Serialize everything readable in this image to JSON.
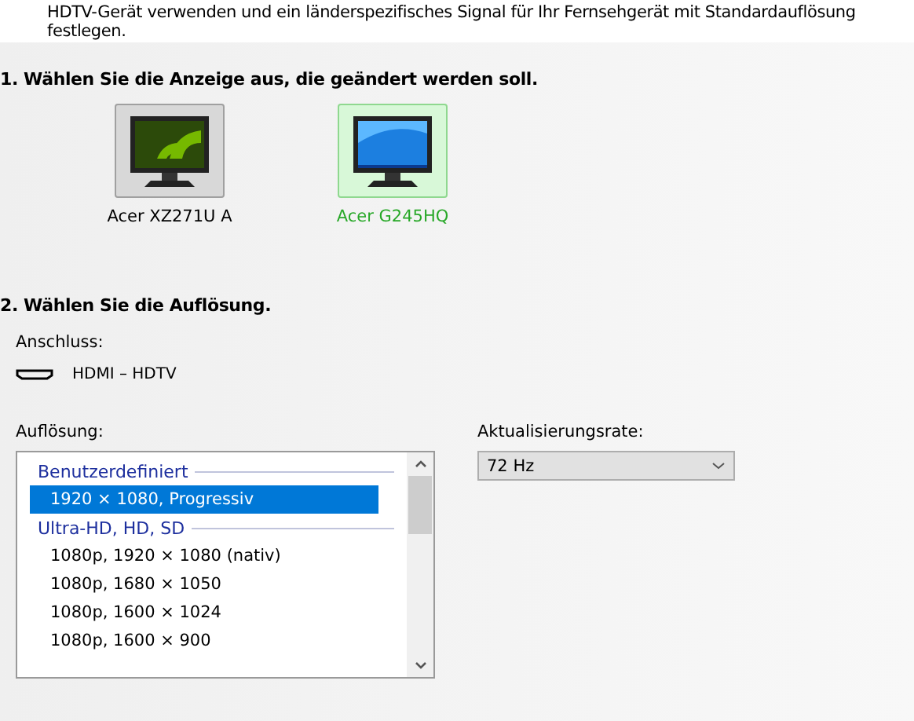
{
  "intro_text": "HDTV-Gerät verwenden und ein länderspezifisches Signal für Ihr Fernsehgerät mit Standardauflösung festlegen.",
  "step1": {
    "heading": "1. Wählen Sie die Anzeige aus, die geändert werden soll.",
    "displays": [
      {
        "name": "Acer XZ271U A",
        "kind": "green",
        "selected": false
      },
      {
        "name": "Acer G245HQ",
        "kind": "blue",
        "selected": true
      }
    ]
  },
  "step2": {
    "heading": "2. Wählen Sie die Auflösung.",
    "connector_label": "Anschluss:",
    "connector": "HDMI – HDTV",
    "resolution_label": "Auflösung:",
    "resolutions": [
      {
        "kind": "group",
        "label": "Benutzerdefiniert"
      },
      {
        "kind": "item",
        "label": "1920 × 1080, Progressiv",
        "selected": true
      },
      {
        "kind": "group",
        "label": "Ultra-HD, HD, SD"
      },
      {
        "kind": "item",
        "label": "1080p, 1920 × 1080 (nativ)",
        "selected": false
      },
      {
        "kind": "item",
        "label": "1080p, 1680 × 1050",
        "selected": false
      },
      {
        "kind": "item",
        "label": "1080p, 1600 × 1024",
        "selected": false
      },
      {
        "kind": "item",
        "label": "1080p, 1600 × 900",
        "selected": false
      }
    ],
    "refresh_label": "Aktualisierungsrate:",
    "refresh_value": "72 Hz"
  }
}
